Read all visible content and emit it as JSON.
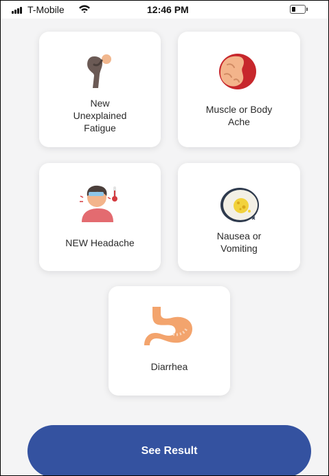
{
  "status_bar": {
    "carrier": "T-Mobile",
    "time": "12:46 PM",
    "icons": [
      "signal-icon",
      "wifi-icon",
      "battery-icon"
    ]
  },
  "symptoms": [
    {
      "label": "New\nUnexplained\nFatigue",
      "icon": "fatigue-person-icon"
    },
    {
      "label": "Muscle or Body\nAche",
      "icon": "muscle-ache-icon"
    },
    {
      "label": "NEW Headache",
      "icon": "headache-person-icon"
    },
    {
      "label": "Nausea or\nVomiting",
      "icon": "nausea-icon"
    },
    {
      "label": "Diarrhea",
      "icon": "stomach-icon"
    }
  ],
  "actions": {
    "see_result": "See Result"
  },
  "colors": {
    "button": "#3452a0",
    "background": "#f4f4f5",
    "card": "#ffffff"
  }
}
